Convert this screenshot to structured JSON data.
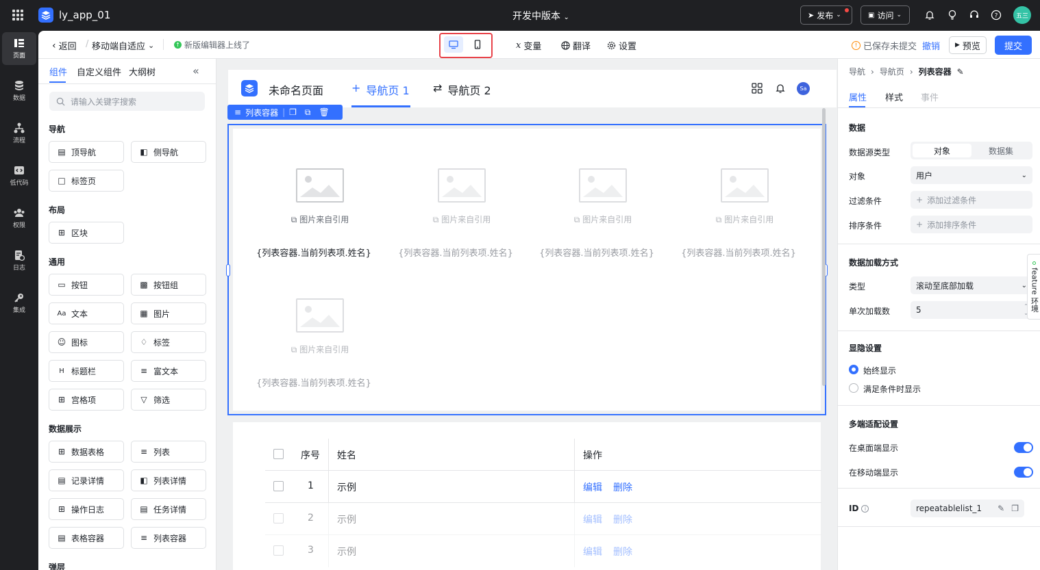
{
  "app": {
    "name": "ly_app_01",
    "version": "开发中版本"
  },
  "topbar": {
    "publish": "发布",
    "visit": "访问",
    "avatar": "五三"
  },
  "rail": [
    {
      "label": "页面",
      "icon": "page-icon"
    },
    {
      "label": "数据",
      "icon": "database-icon"
    },
    {
      "label": "流程",
      "icon": "flow-icon"
    },
    {
      "label": "低代码",
      "icon": "code-icon"
    },
    {
      "label": "权限",
      "icon": "users-icon"
    },
    {
      "label": "日志",
      "icon": "log-icon"
    },
    {
      "label": "集成",
      "icon": "key-icon"
    }
  ],
  "toolbar": {
    "back": "返回",
    "page_mode": "移动端自适应",
    "notice": "新版编辑器上线了",
    "variables": "变量",
    "translate": "翻译",
    "settings": "设置",
    "saved_status": "已保存未提交",
    "undo": "撤销",
    "preview": "预览",
    "submit": "提交"
  },
  "panel": {
    "tabs": [
      "组件",
      "自定义组件",
      "大纲树"
    ],
    "search_placeholder": "请输入关键字搜索",
    "sections": {
      "nav": "导航",
      "layout": "布局",
      "common": "通用",
      "data": "数据展示",
      "popup": "弹层"
    },
    "items": {
      "top_nav": "顶导航",
      "side_nav": "侧导航",
      "tab_page": "标签页",
      "block": "区块",
      "button": "按钮",
      "button_group": "按钮组",
      "text": "文本",
      "image": "图片",
      "icon": "图标",
      "tag": "标签",
      "title_bar": "标题栏",
      "rich_text": "富文本",
      "grid_item": "宫格项",
      "filter": "筛选",
      "data_table": "数据表格",
      "list": "列表",
      "record_detail": "记录详情",
      "list_detail": "列表详情",
      "op_log": "操作日志",
      "task_detail": "任务详情",
      "table_container": "表格容器",
      "list_container": "列表容器"
    }
  },
  "canvas": {
    "page_title": "未命名页面",
    "nav1": "导航页 1",
    "nav2": "导航页 2",
    "user_badge": "Sa",
    "selected_label": "列表容器",
    "image_caption": "图片来自引用",
    "item_name": "{列表容器.当前列表项.姓名}",
    "table": {
      "headers": [
        "序号",
        "姓名",
        "操作"
      ],
      "rows": [
        {
          "no": "1",
          "name": "示例",
          "edit": "编辑",
          "delete": "删除"
        },
        {
          "no": "2",
          "name": "示例",
          "edit": "编辑",
          "delete": "删除"
        },
        {
          "no": "3",
          "name": "示例",
          "edit": "编辑",
          "delete": "删除"
        }
      ]
    }
  },
  "props": {
    "breadcrumb": [
      "导航",
      "导航页",
      "列表容器"
    ],
    "tabs": [
      "属性",
      "样式",
      "事件"
    ],
    "data_section": "数据",
    "source_type_label": "数据源类型",
    "source_type_options": [
      "对象",
      "数据集"
    ],
    "object_label": "对象",
    "object_value": "用户",
    "filter_label": "过滤条件",
    "filter_add": "添加过滤条件",
    "sort_label": "排序条件",
    "sort_add": "添加排序条件",
    "load_section": "数据加载方式",
    "type_label": "类型",
    "type_value": "滚动至底部加载",
    "batch_label": "单次加载数",
    "batch_value": "5",
    "visibility_section": "显隐设置",
    "always_show": "始终显示",
    "conditional_show": "满足条件时显示",
    "multi_section": "多端适配设置",
    "desktop_show": "在桌面端显示",
    "mobile_show": "在移动端显示",
    "id_label": "ID",
    "id_value": "repeatablelist_1",
    "feature_tab": "feature 环境"
  }
}
